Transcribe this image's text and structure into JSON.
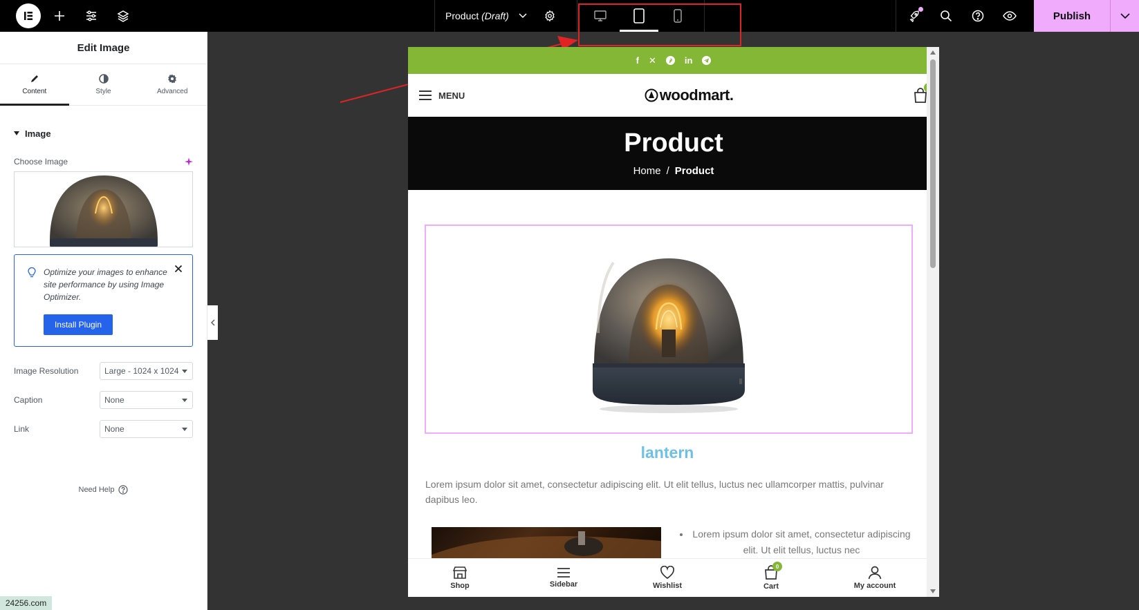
{
  "topbar": {
    "doc_title": "Product",
    "doc_status": "(Draft)",
    "publish_label": "Publish"
  },
  "panel": {
    "title": "Edit Image",
    "tabs": [
      {
        "label": "Content"
      },
      {
        "label": "Style"
      },
      {
        "label": "Advanced"
      }
    ],
    "section_title": "Image",
    "choose_image_label": "Choose Image",
    "notice_text": "Optimize your images to enhance site performance by using Image Optimizer.",
    "install_label": "Install Plugin",
    "controls": [
      {
        "label": "Image Resolution",
        "value": "Large - 1024 x 1024"
      },
      {
        "label": "Caption",
        "value": "None"
      },
      {
        "label": "Link",
        "value": "None"
      }
    ],
    "need_help": "Need Help"
  },
  "watermark": "24256.com",
  "preview": {
    "menu_label": "MENU",
    "brand": "woodmart.",
    "cart_count": "0",
    "page_title": "Product",
    "crumbs": {
      "home": "Home",
      "sep": "/",
      "current": "Product"
    },
    "product_title": "lantern",
    "lorem": "Lorem ipsum dolor sit amet, consectetur adipiscing elit. Ut elit tellus, luctus nec ullamcorper mattis, pulvinar dapibus leo.",
    "bullet": "Lorem ipsum dolor sit amet, consectetur adipiscing elit. Ut elit tellus, luctus nec",
    "bottom_nav": [
      {
        "label": "Shop",
        "icon": "shop-icon"
      },
      {
        "label": "Sidebar",
        "icon": "sidebar-icon"
      },
      {
        "label": "Wishlist",
        "icon": "heart-icon"
      },
      {
        "label": "Cart",
        "icon": "cart-icon",
        "badge": "0"
      },
      {
        "label": "My account",
        "icon": "user-icon"
      }
    ]
  },
  "colors": {
    "accent_green": "#83b735",
    "publish_pink": "#f0abfc",
    "editor_blue": "#2563eb",
    "title_blue": "#6ec1e4",
    "highlight_red": "#e02424"
  }
}
